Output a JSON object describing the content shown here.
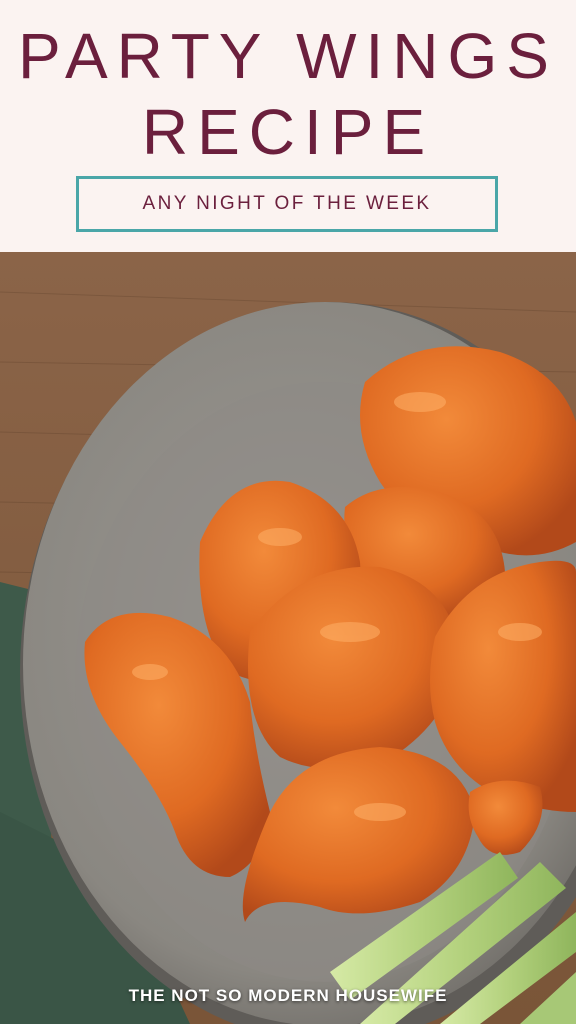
{
  "header": {
    "title_line1": "PARTY WINGS",
    "title_line2": "RECIPE",
    "subtitle": "ANY NIGHT OF THE WEEK"
  },
  "photo": {
    "subject": "plate of buffalo wings with celery sticks",
    "colors": {
      "table": "#8a6346",
      "napkin": "#3e5a4a",
      "plate": "#8f8c87",
      "sauce": "#e0702a",
      "celery": "#b9d58a"
    }
  },
  "footer": {
    "brand": "THE NOT SO MODERN HOUSEWIFE"
  },
  "colors": {
    "background": "#fbf3f1",
    "title": "#6b1f3d",
    "border": "#4aa6a8"
  }
}
